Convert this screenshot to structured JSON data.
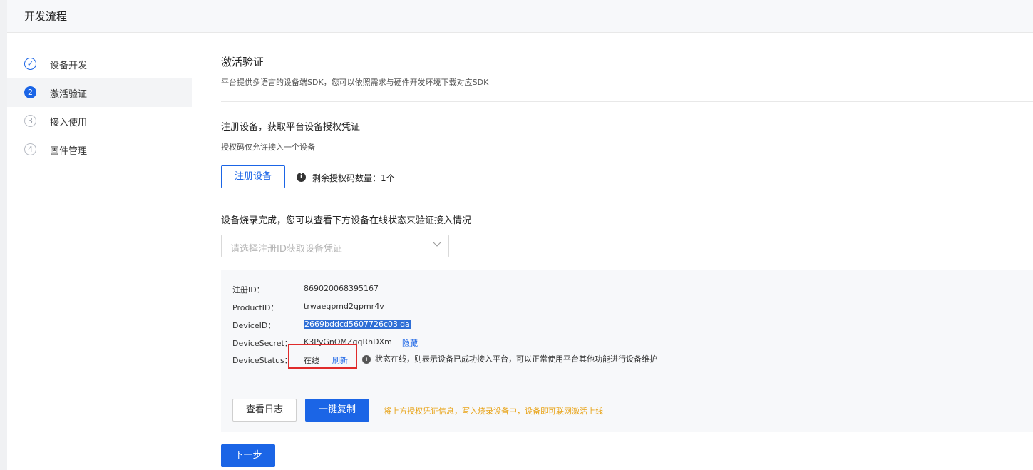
{
  "header": {
    "title": "开发流程"
  },
  "sidebar": {
    "steps": [
      {
        "number": "✓",
        "label": "设备开发"
      },
      {
        "number": "2",
        "label": "激活验证"
      },
      {
        "number": "3",
        "label": "接入使用"
      },
      {
        "number": "4",
        "label": "固件管理"
      }
    ]
  },
  "main": {
    "title": "激活验证",
    "description": "平台提供多语言的设备端SDK，您可以依照需求与硬件开发环境下载对应SDK",
    "register": {
      "title": "注册设备，获取平台设备授权凭证",
      "note": "授权码仅允许接入一个设备",
      "button": "注册设备",
      "remaining": "剩余授权码数量：1个"
    },
    "verify": {
      "title": "设备烧录完成，您可以查看下方设备在线状态来验证接入情况",
      "select_placeholder": "请选择注册ID获取设备凭证"
    },
    "credentials": {
      "register_id_label": "注册ID：",
      "register_id": "869020068395167",
      "product_id_label": "ProductID：",
      "product_id": "trwaegpmd2gpmr4v",
      "device_id_label": "DeviceID：",
      "device_id": "2669bddcd5607726c03lda",
      "device_secret_label": "DeviceSecret：",
      "device_secret": "K3PyGnOMZqqRhDXm",
      "hide_link": "隐藏",
      "device_status_label": "DeviceStatus：",
      "device_status": "在线",
      "refresh_link": "刷新",
      "status_note": "状态在线，则表示设备已成功接入平台，可以正常使用平台其他功能进行设备维护"
    },
    "actions": {
      "view_log": "查看日志",
      "copy_all": "一键复制",
      "tip": "将上方授权凭证信息，写入烧录设备中，设备即可联网激活上线"
    },
    "next": "下一步"
  }
}
